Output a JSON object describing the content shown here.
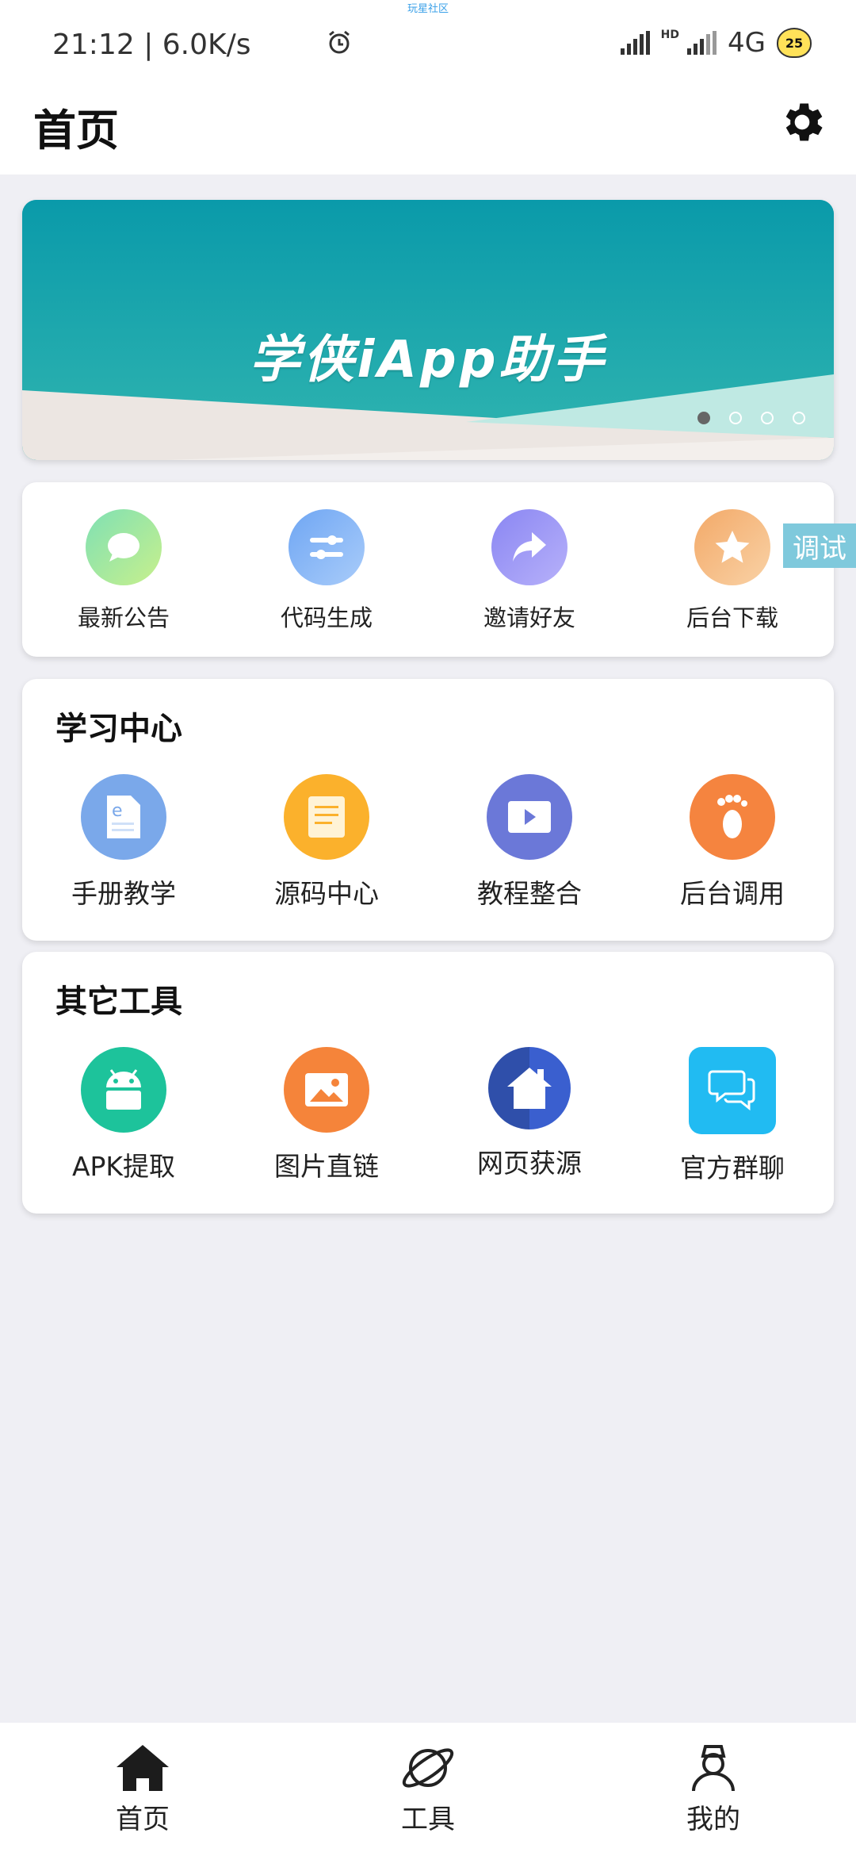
{
  "status_bar": {
    "watermark": "玩星社区",
    "time_speed": "21:12 | 6.0K/s",
    "hd": "HD",
    "network": "4G",
    "badge": "25"
  },
  "header": {
    "title": "首页"
  },
  "banner": {
    "text": "学侠iApp助手",
    "slide_count": 4,
    "active_slide": 1
  },
  "shortcuts": [
    {
      "label": "最新公告",
      "icon": "chat-bubble-icon"
    },
    {
      "label": "代码生成",
      "icon": "sliders-icon"
    },
    {
      "label": "邀请好友",
      "icon": "share-arrow-icon"
    },
    {
      "label": "后台下载",
      "icon": "star-icon"
    }
  ],
  "debug_button": "调试",
  "learning": {
    "title": "学习中心",
    "items": [
      {
        "label": "手册教学",
        "icon": "document-icon"
      },
      {
        "label": "源码中心",
        "icon": "notes-icon"
      },
      {
        "label": "教程整合",
        "icon": "video-play-icon"
      },
      {
        "label": "后台调用",
        "icon": "footprint-icon"
      }
    ]
  },
  "tools": {
    "title": "其它工具",
    "items": [
      {
        "label": "APK提取",
        "icon": "android-icon"
      },
      {
        "label": "图片直链",
        "icon": "image-icon"
      },
      {
        "label": "网页获源",
        "icon": "home-icon"
      },
      {
        "label": "官方群聊",
        "icon": "chat-icon"
      }
    ]
  },
  "bottom_nav": [
    {
      "label": "首页",
      "icon": "home-icon"
    },
    {
      "label": "工具",
      "icon": "planet-icon"
    },
    {
      "label": "我的",
      "icon": "user-icon"
    }
  ],
  "colors": {
    "background": "#efeff4",
    "banner": "#1aa9ac",
    "announce": "#a8e6a0",
    "codegen": "#7fb3f5",
    "invite": "#9b95f5",
    "download": "#f5b97a",
    "manual": "#7aa8ea",
    "source": "#fbb12c",
    "tutorial": "#6b78d8",
    "backend": "#f5843f",
    "apk": "#1dc39b",
    "image": "#f5843a",
    "web": "#2f4faa",
    "group": "#21bbf2"
  }
}
